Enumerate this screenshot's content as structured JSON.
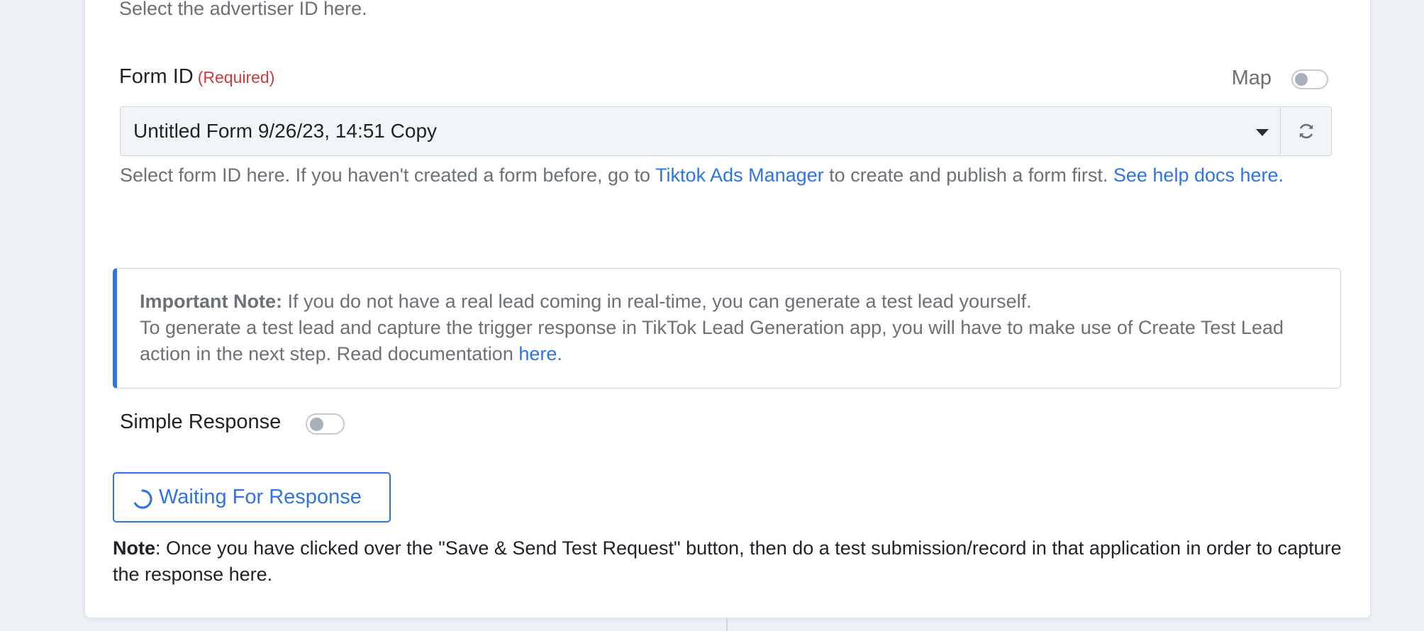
{
  "advertiser": {
    "help": "Select the advertiser ID here."
  },
  "form_id": {
    "label": "Form ID",
    "required": "(Required)",
    "map_label": "Map",
    "selected": "Untitled Form 9/26/23, 14:51 Copy",
    "help_prefix": "Select form ID here. If you haven't created a form before, go to ",
    "help_link1": "Tiktok Ads Manager",
    "help_middle": " to create and publish a form first. ",
    "help_link2": "See help docs here."
  },
  "important_note": {
    "title": "Important Note:",
    "line1": " If you do not have a real lead coming in real-time, you can generate a test lead yourself.",
    "line2": "To generate a test lead and capture the trigger response in TikTok Lead Generation app, you will have to make use of Create Test Lead action in the next step. Read documentation ",
    "link": "here."
  },
  "simple_response": {
    "label": "Simple Response"
  },
  "waiting_button": {
    "label": "Waiting For Response"
  },
  "bottom_note": {
    "title": "Note",
    "text": ": Once you have clicked over the \"Save & Send Test Request\" button, then do a test submission/record in that application in order to capture the response here."
  },
  "colors": {
    "accent": "#2d74e4",
    "required": "#cf3a3a",
    "muted_text": "#6b7079"
  },
  "icons": {
    "dropdown": "caret-down-icon",
    "refresh": "refresh-icon",
    "spinner": "spinner-icon"
  }
}
